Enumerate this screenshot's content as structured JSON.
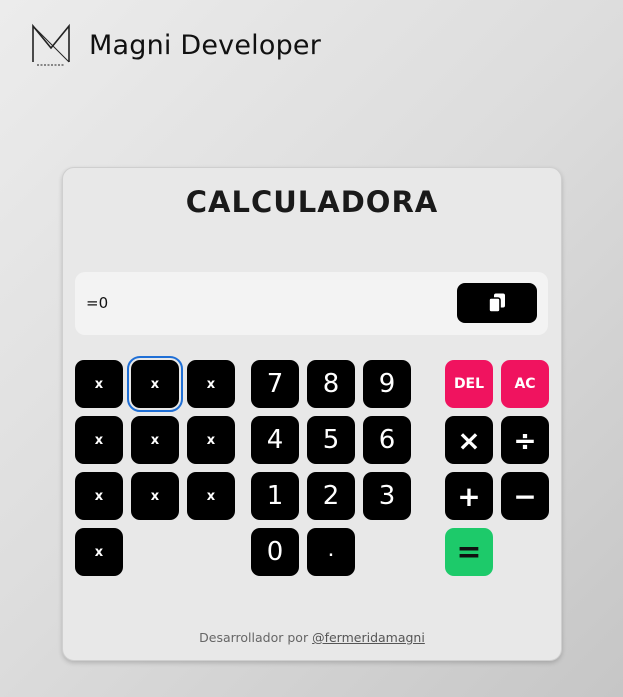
{
  "header": {
    "brand_name": "Magni Developer",
    "logo_icon": "magni-logo-icon"
  },
  "calculator": {
    "title": "CALCULADORA",
    "display_value": "=0",
    "copy_icon": "copy-icon",
    "left_keys": [
      "x",
      "x",
      "x",
      "x",
      "x",
      "x",
      "x",
      "x",
      "x",
      "x"
    ],
    "number_keys": [
      "7",
      "8",
      "9",
      "4",
      "5",
      "6",
      "1",
      "2",
      "3",
      "0",
      "."
    ],
    "delete_label": "DEL",
    "clear_label": "AC",
    "multiply_label": "×",
    "divide_label": "÷",
    "add_label": "+",
    "subtract_label": "−",
    "equals_label": "=",
    "colors": {
      "key_bg": "#000000",
      "accent_pink": "#f0135f",
      "accent_green": "#1dca6a",
      "focus_ring": "#1f6fd6"
    }
  },
  "footer": {
    "prefix": "Desarrollador por",
    "link_text": "@fermeridamagni"
  }
}
